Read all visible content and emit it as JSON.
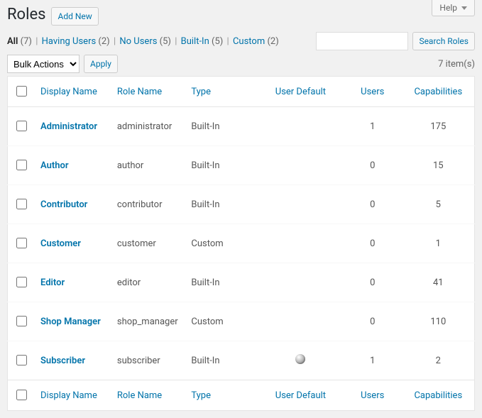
{
  "help_label": "Help",
  "page_title": "Roles",
  "add_new_label": "Add New",
  "search": {
    "placeholder": "",
    "button": "Search Roles"
  },
  "filters": {
    "all_label": "All",
    "all_count": "(7)",
    "having_label": "Having Users",
    "having_count": "(2)",
    "no_label": "No Users",
    "no_count": "(5)",
    "builtin_label": "Built-In",
    "builtin_count": "(5)",
    "custom_label": "Custom",
    "custom_count": "(2)"
  },
  "bulk": {
    "actions": "Bulk Actions",
    "apply": "Apply"
  },
  "items_count": "7 item(s)",
  "columns": {
    "display_name": "Display Name",
    "role_name": "Role Name",
    "type": "Type",
    "user_default": "User Default",
    "users": "Users",
    "capabilities": "Capabilities"
  },
  "rows": [
    {
      "display": "Administrator",
      "role": "administrator",
      "type": "Built-In",
      "default": false,
      "users": "1",
      "caps": "175"
    },
    {
      "display": "Author",
      "role": "author",
      "type": "Built-In",
      "default": false,
      "users": "0",
      "caps": "15"
    },
    {
      "display": "Contributor",
      "role": "contributor",
      "type": "Built-In",
      "default": false,
      "users": "0",
      "caps": "5"
    },
    {
      "display": "Customer",
      "role": "customer",
      "type": "Custom",
      "default": false,
      "users": "0",
      "caps": "1"
    },
    {
      "display": "Editor",
      "role": "editor",
      "type": "Built-In",
      "default": false,
      "users": "0",
      "caps": "41"
    },
    {
      "display": "Shop Manager",
      "role": "shop_manager",
      "type": "Custom",
      "default": false,
      "users": "0",
      "caps": "110"
    },
    {
      "display": "Subscriber",
      "role": "subscriber",
      "type": "Built-In",
      "default": true,
      "users": "1",
      "caps": "2"
    }
  ]
}
